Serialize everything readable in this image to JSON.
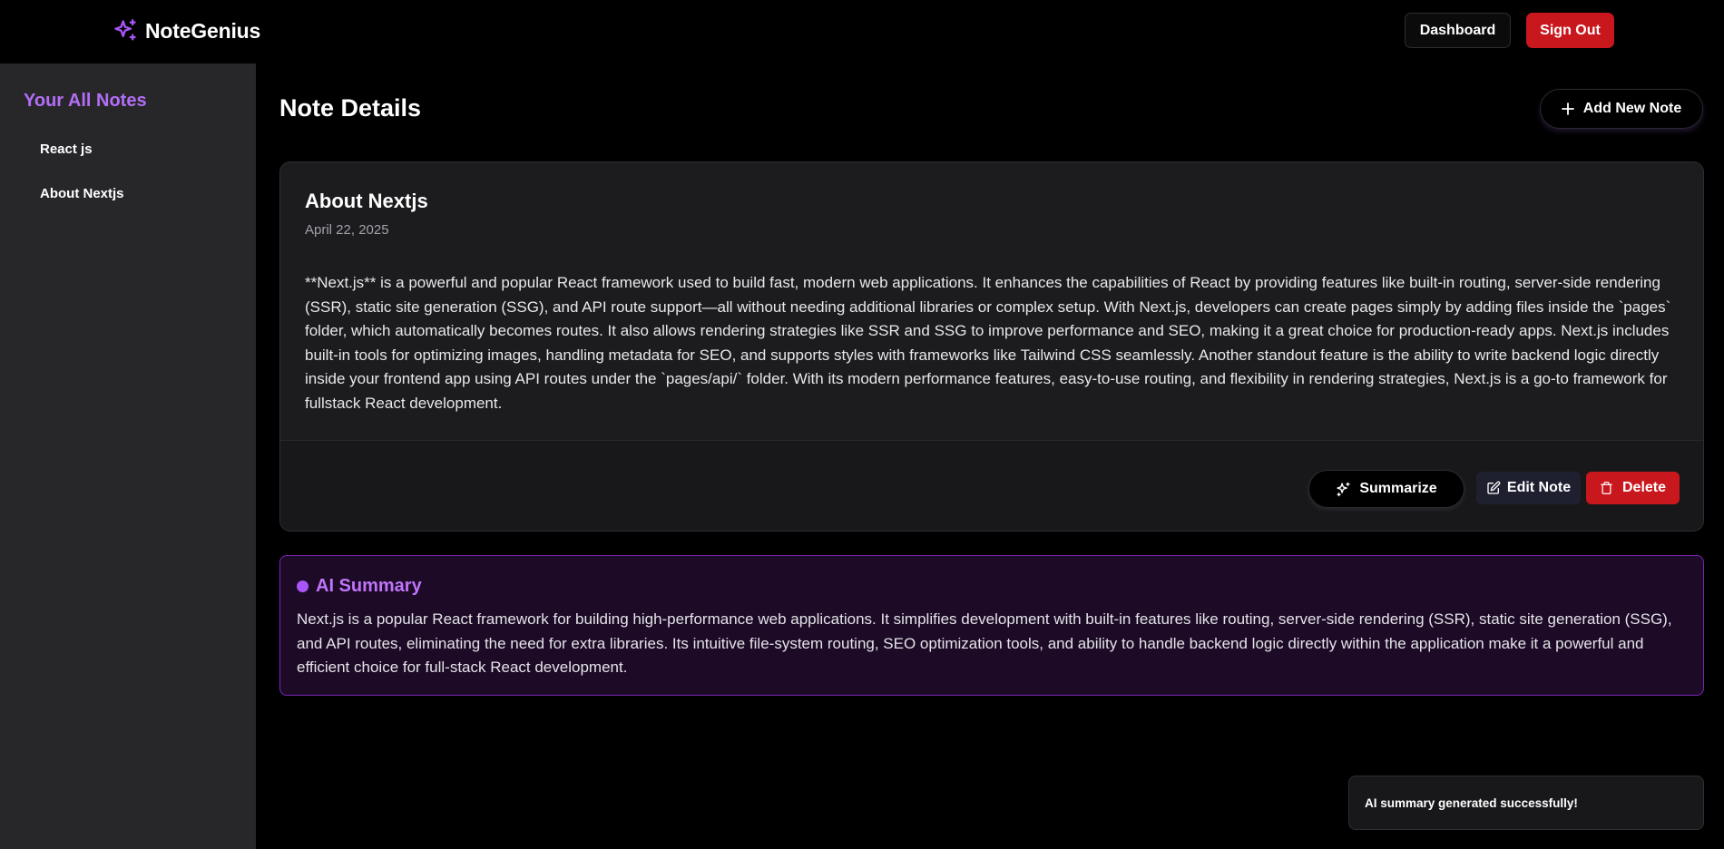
{
  "header": {
    "brand_name": "NoteGenius",
    "brand_icon": "sparkles-icon",
    "dashboard_label": "Dashboard",
    "signout_label": "Sign Out"
  },
  "sidebar": {
    "title": "Your All Notes",
    "items": [
      {
        "label": "React js"
      },
      {
        "label": "About Nextjs"
      }
    ]
  },
  "main": {
    "page_title": "Note Details",
    "add_note_label": "Add New Note",
    "note": {
      "title": "About Nextjs",
      "date": "April 22, 2025",
      "content": "**Next.js** is a powerful and popular React framework used to build fast, modern web applications. It enhances the capabilities of React by providing features like built-in routing, server-side rendering (SSR), static site generation (SSG), and API route support—all without needing additional libraries or complex setup. With Next.js, developers can create pages simply by adding files inside the `pages` folder, which automatically becomes routes. It also allows rendering strategies like SSR and SSG to improve performance and SEO, making it a great choice for production-ready apps. Next.js includes built-in tools for optimizing images, handling metadata for SEO, and supports styles with frameworks like Tailwind CSS seamlessly. Another standout feature is the ability to write backend logic directly inside your frontend app using API routes under the `pages/api/` folder. With its modern performance features, easy-to-use routing, and flexibility in rendering strategies, Next.js is a go-to framework for fullstack React development."
    },
    "actions": {
      "summarize_label": "Summarize",
      "edit_label": "Edit Note",
      "delete_label": "Delete"
    },
    "summary": {
      "title": "AI Summary",
      "text": "Next.js is a popular React framework for building high-performance web applications. It simplifies development with built-in features like routing, server-side rendering (SSR), static site generation (SSG), and API routes, eliminating the need for extra libraries. Its intuitive file-system routing, SEO optimization tools, and ability to handle backend logic directly within the application make it a powerful and efficient choice for full-stack React development."
    }
  },
  "toast": {
    "message": "AI summary generated successfully!"
  },
  "colors": {
    "accent": "#b36ef5",
    "danger": "#c9171e",
    "sidebar_bg": "#27272a",
    "card_bg": "#1c1c1f",
    "summary_bg": "#1c0a27",
    "summary_border": "#7a24b8"
  }
}
